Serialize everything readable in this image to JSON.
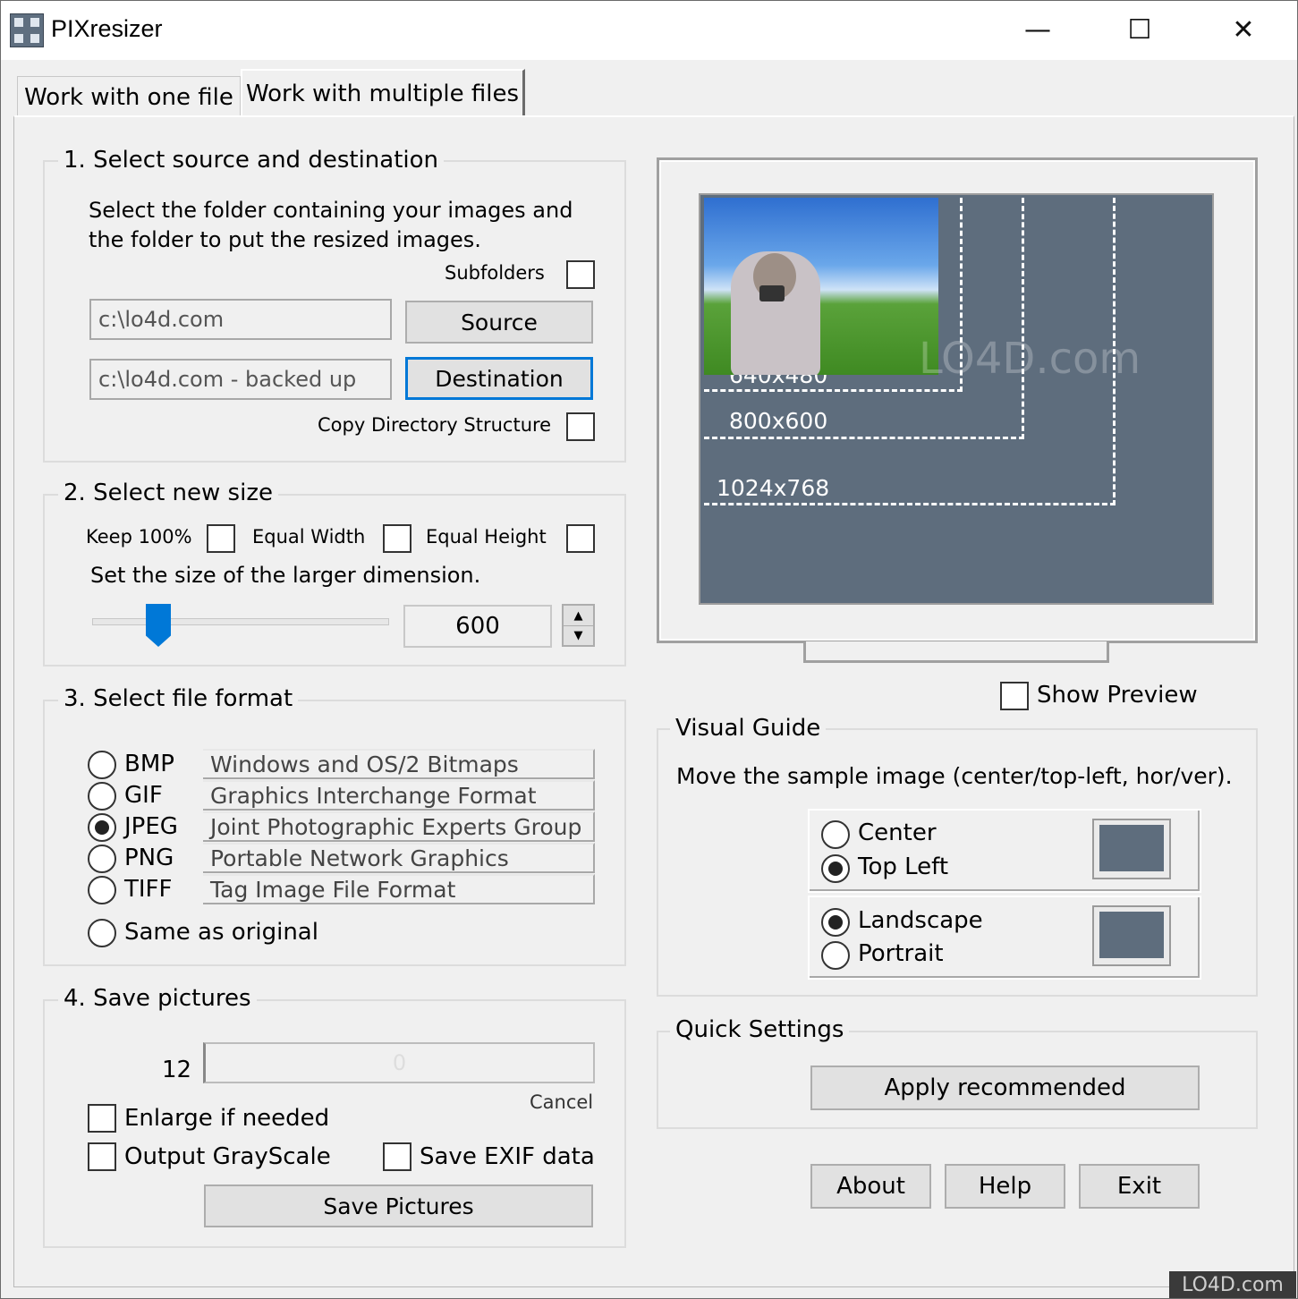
{
  "window": {
    "title": "PIXresizer",
    "minimize_glyph": "—",
    "maximize_glyph": "☐",
    "close_glyph": "✕"
  },
  "tabs": [
    {
      "label": "Work with one file"
    },
    {
      "label": "Work with multiple files"
    }
  ],
  "section1": {
    "title": "1. Select source and destination",
    "description_line1": "Select the folder containing your images and",
    "description_line2": "the folder to put the resized images.",
    "subfolders_label": "Subfolders",
    "source_path": "c:\\lo4d.com",
    "source_button": "Source",
    "destination_path": "c:\\lo4d.com - backed up",
    "destination_button": "Destination",
    "copy_dir_label": "Copy Directory Structure"
  },
  "section2": {
    "title": "2. Select new size",
    "keep100_label": "Keep 100%",
    "equal_width_label": "Equal Width",
    "equal_height_label": "Equal Height",
    "size_hint": "Set the size of the larger dimension.",
    "size_value": "600"
  },
  "section3": {
    "title": "3. Select file format",
    "formats": [
      {
        "name": "BMP",
        "desc": "Windows and OS/2 Bitmaps",
        "selected": false
      },
      {
        "name": "GIF",
        "desc": "Graphics Interchange Format",
        "selected": false
      },
      {
        "name": "JPEG",
        "desc": "Joint Photographic Experts Group",
        "selected": true
      },
      {
        "name": "PNG",
        "desc": "Portable Network Graphics",
        "selected": false
      },
      {
        "name": "TIFF",
        "desc": "Tag Image File Format",
        "selected": false
      }
    ],
    "same_as_original": "Same as original"
  },
  "section4": {
    "title": "4. Save pictures",
    "file_count": "12",
    "progress_value": "0",
    "cancel_label": "Cancel",
    "enlarge_label": "Enlarge if needed",
    "grayscale_label": "Output GrayScale",
    "exif_label": "Save EXIF data",
    "save_button": "Save Pictures"
  },
  "preview": {
    "res_640": "640x480",
    "res_800": "800x600",
    "res_1024": "1024x768",
    "watermark": "LO4D.com",
    "show_preview_label": "Show Preview"
  },
  "visual_guide": {
    "title": "Visual Guide",
    "description": "Move the sample image (center/top-left, hor/ver).",
    "center_label": "Center",
    "topleft_label": "Top Left",
    "landscape_label": "Landscape",
    "portrait_label": "Portrait"
  },
  "quick_settings": {
    "title": "Quick Settings",
    "apply_button": "Apply recommended"
  },
  "footer": {
    "about_button": "About",
    "help_button": "Help",
    "exit_button": "Exit",
    "watermark": "LO4D.com"
  },
  "colors": {
    "accent": "#0078d7",
    "screen": "#5e6d7d",
    "face": "#f0f0f0"
  }
}
